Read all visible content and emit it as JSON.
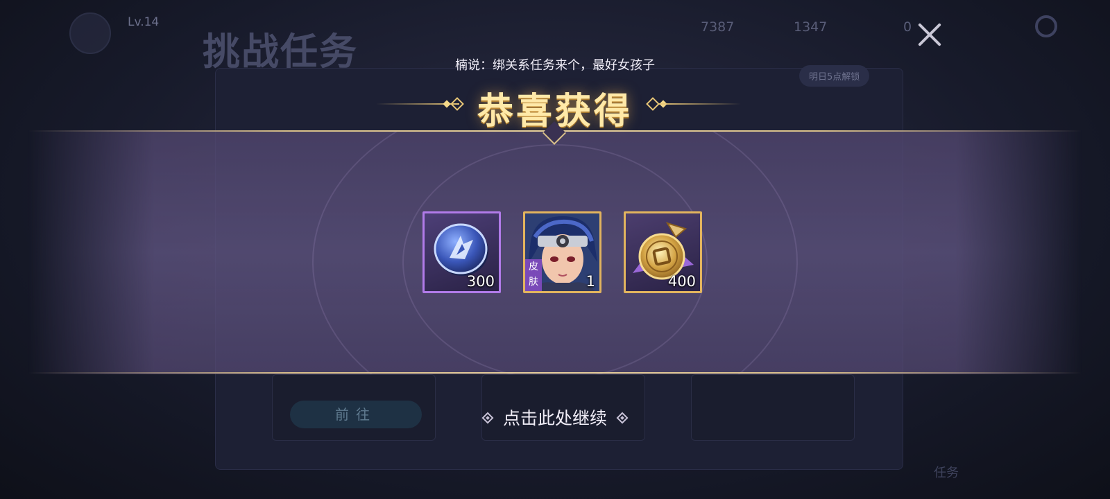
{
  "background": {
    "level": "Lv.14",
    "page_title": "挑战任务",
    "currency_1": "7387",
    "currency_2": "1347",
    "currency_3": "0",
    "badge": "明日5点解锁",
    "go_button": "前往",
    "nav_tasks": "任务"
  },
  "overlay": {
    "subtitle": "楠说：绑关系任务来个，最好女孩子",
    "title": "恭喜获得",
    "continue_label": "点击此处继续"
  },
  "rewards": [
    {
      "name": "blue-token",
      "count": "300",
      "rarity": "purple",
      "icon": "blue-coin-icon"
    },
    {
      "name": "hero-skin",
      "count": "1",
      "tag": "皮肤",
      "rarity": "gold",
      "icon": "hero-portrait-icon"
    },
    {
      "name": "gold-medal",
      "count": "400",
      "rarity": "gold",
      "icon": "gold-medal-icon"
    }
  ],
  "colors": {
    "accent_gold": "#e9c777",
    "rarity_purple": "#b17be9",
    "rarity_gold": "#e2b45e",
    "band": "#5f5480"
  }
}
